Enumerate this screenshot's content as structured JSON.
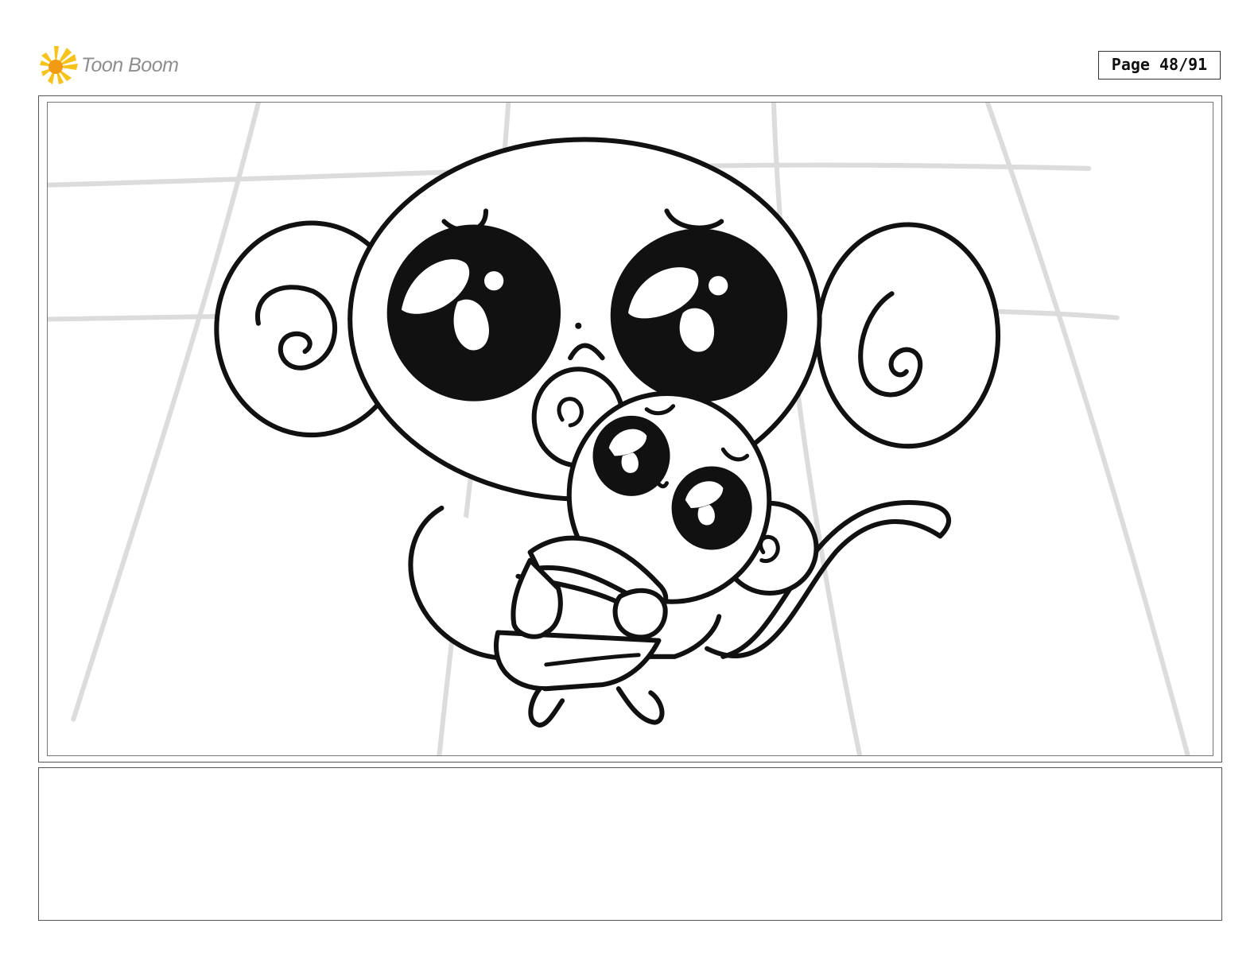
{
  "header": {
    "logo_text": "Toon Boom",
    "logo_icon": "starburst-logo-icon",
    "page_label": "Page 48/91"
  },
  "panel": {
    "description_icon": "storyboard-drawing",
    "colors": {
      "line": "#111111",
      "guide": "#dcdcdc",
      "fill": "#ffffff"
    }
  },
  "notes": {
    "text": ""
  }
}
